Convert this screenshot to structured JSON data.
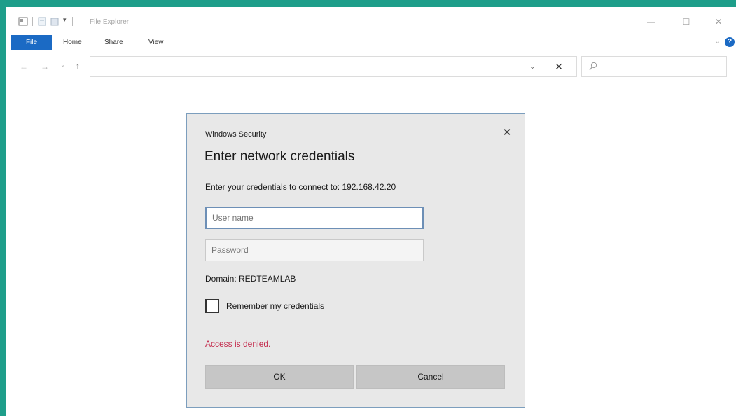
{
  "window": {
    "title": "File Explorer",
    "controls": {
      "minimize": "—",
      "maximize": "☐",
      "close": "✕"
    }
  },
  "ribbon": {
    "tabs": [
      "File",
      "Home",
      "Share",
      "View"
    ],
    "collapse_glyph": "⌄",
    "help_glyph": "?"
  },
  "nav": {
    "back": "←",
    "forward": "→",
    "recent": "⌄",
    "up": "↑"
  },
  "address": {
    "dropdown": "⌄",
    "clear": "✕",
    "value": ""
  },
  "dialog": {
    "caption": "Windows Security",
    "close": "✕",
    "heading": "Enter network credentials",
    "description": "Enter your credentials to connect to: 192.168.42.20",
    "username_placeholder": "User name",
    "password_placeholder": "Password",
    "domain": "Domain: REDTEAMLAB",
    "remember_label": "Remember my credentials",
    "remember_checked": false,
    "error": "Access is denied.",
    "ok_label": "OK",
    "cancel_label": "Cancel"
  },
  "colors": {
    "desktop": "#1e9e8a",
    "file_tab": "#1b6ac4",
    "dialog_bg": "#e8e8e8",
    "dialog_border": "#7c9ebd",
    "error": "#c4294b"
  }
}
